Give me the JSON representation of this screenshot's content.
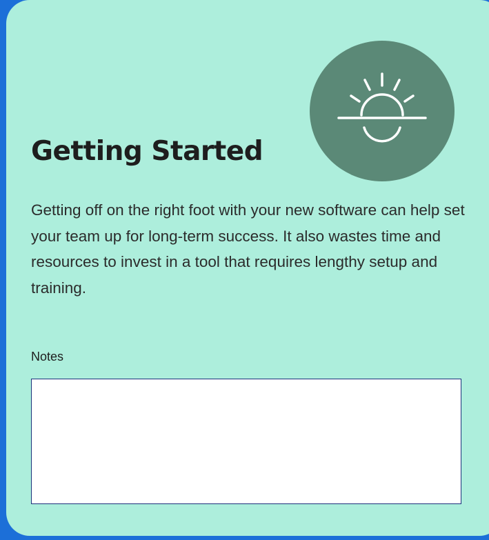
{
  "card": {
    "icon": "sunrise-icon",
    "title": "Getting Started",
    "description": "Getting off on the right foot with your new software can help set your team up for long-term success. It also wastes time and resources to invest in a tool that requires lengthy setup and training.",
    "notes": {
      "label": "Notes",
      "value": "",
      "placeholder": ""
    }
  },
  "colors": {
    "frame": "#1c6fd8",
    "card_background": "#adeedc",
    "icon_badge": "#5b8977",
    "icon_stroke": "#ffffff",
    "notes_border": "#1a2f7a"
  }
}
